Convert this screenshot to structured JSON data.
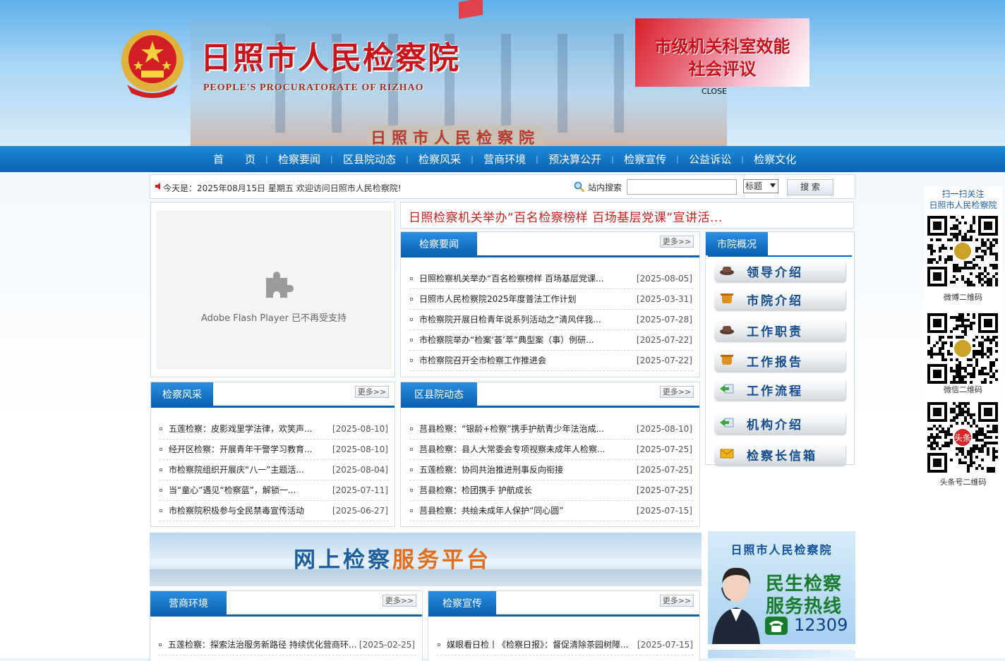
{
  "header": {
    "title": "日照市人民检察院",
    "subtitle": "PEOPLE'S PROCURATORATE OF RIZHAO",
    "sign": "日照市人民检察院",
    "ad_line1": "市级机关科室效能",
    "ad_line2": "社会评议",
    "ad_close": "CLOSE"
  },
  "nav": {
    "items": [
      "首　　页",
      "检察要闻",
      "区县院动态",
      "检察风采",
      "营商环境",
      "预决算公开",
      "检察宣传",
      "公益诉讼",
      "检察文化"
    ]
  },
  "infobar": {
    "date_text": "今天是：2025年08月15日 星期五 欢迎访问日照市人民检察院!",
    "search_label": "站内搜索",
    "search_value": "",
    "select_value": "标题",
    "search_button": "搜 索"
  },
  "flash": {
    "message": "Adobe Flash Player 已不再受支持"
  },
  "headline": "日照检察机关举办“百名检察榜样 百场基层党课”宣讲活...",
  "more_label": "更多>>",
  "news": {
    "title": "检察要闻",
    "items": [
      {
        "title": "日照检察机关举办“百名检察榜样 百场基层党课...",
        "date": "[2025-08-05]"
      },
      {
        "title": "日照市人民检察院2025年度普法工作计划",
        "date": "[2025-03-31]"
      },
      {
        "title": "市检察院开展日检青年说系列活动之“清风伴我...",
        "date": "[2025-07-28]"
      },
      {
        "title": "市检察院举办“检案‘荟’萃”典型案（事）例研...",
        "date": "[2025-07-22]"
      },
      {
        "title": "市检察院召开全市检察工作推进会",
        "date": "[2025-07-22]"
      }
    ]
  },
  "overview": {
    "title": "市院概况",
    "items": [
      "领导介绍",
      "市院介绍",
      "工作职责",
      "工作报告",
      "工作流程",
      "机构介绍",
      "检察长信箱"
    ]
  },
  "style_news": {
    "title": "检察风采",
    "items": [
      {
        "title": "五莲检察：皮影戏里学法律，欢笑声...",
        "date": "[2025-08-10]"
      },
      {
        "title": "经开区检察：开展青年干警学习教育...",
        "date": "[2025-08-10]"
      },
      {
        "title": "市检察院组织开展庆“八一”主题活...",
        "date": "[2025-08-04]"
      },
      {
        "title": "当“童心”遇见“检察蓝”，解锁一...",
        "date": "[2025-07-11]"
      },
      {
        "title": "市检察院积极参与全民禁毒宣传活动",
        "date": "[2025-06-27]"
      }
    ]
  },
  "district": {
    "title": "区县院动态",
    "items": [
      {
        "title": "莒县检察：“银龄+检察”携手护航青少年法治成...",
        "date": "[2025-08-10]"
      },
      {
        "title": "莒县检察：县人大常委会专项视察未成年人检察...",
        "date": "[2025-07-25]"
      },
      {
        "title": "五莲检察：协同共治推进刑事反向衔接",
        "date": "[2025-07-25]"
      },
      {
        "title": "莒县检察：检团携手 护航成长",
        "date": "[2025-07-25]"
      },
      {
        "title": "莒县检察：共绘未成年人保护“同心圆”",
        "date": "[2025-07-15]"
      }
    ]
  },
  "service_banner": {
    "part1": "网上检察",
    "part2": "服务平台"
  },
  "hotline": {
    "org": "日照市人民检察院",
    "line1": "民生检察",
    "line2": "服务热线",
    "number": "12309"
  },
  "biz": {
    "title": "营商环境",
    "items": [
      {
        "title": "五莲检察：探索法治服务新路径 持续优化营商环...",
        "date": "[2025-02-25]"
      }
    ]
  },
  "promo": {
    "title": "检察宣传",
    "items": [
      {
        "title": "媒眼看日检丨《检察日报》：督促清除茶园树障...",
        "date": "[2025-07-15]"
      }
    ]
  },
  "qr_side": {
    "head1": "扫一扫关注",
    "head2": "日照市人民检察院",
    "captions": [
      "微博二维码",
      "微信二维码",
      "头条号二维码"
    ],
    "toutiao_badge": "头条"
  },
  "colors": {
    "nav_blue": "#0b62b3",
    "title_red": "#c8141b",
    "accent_orange": "#e06d1a"
  }
}
